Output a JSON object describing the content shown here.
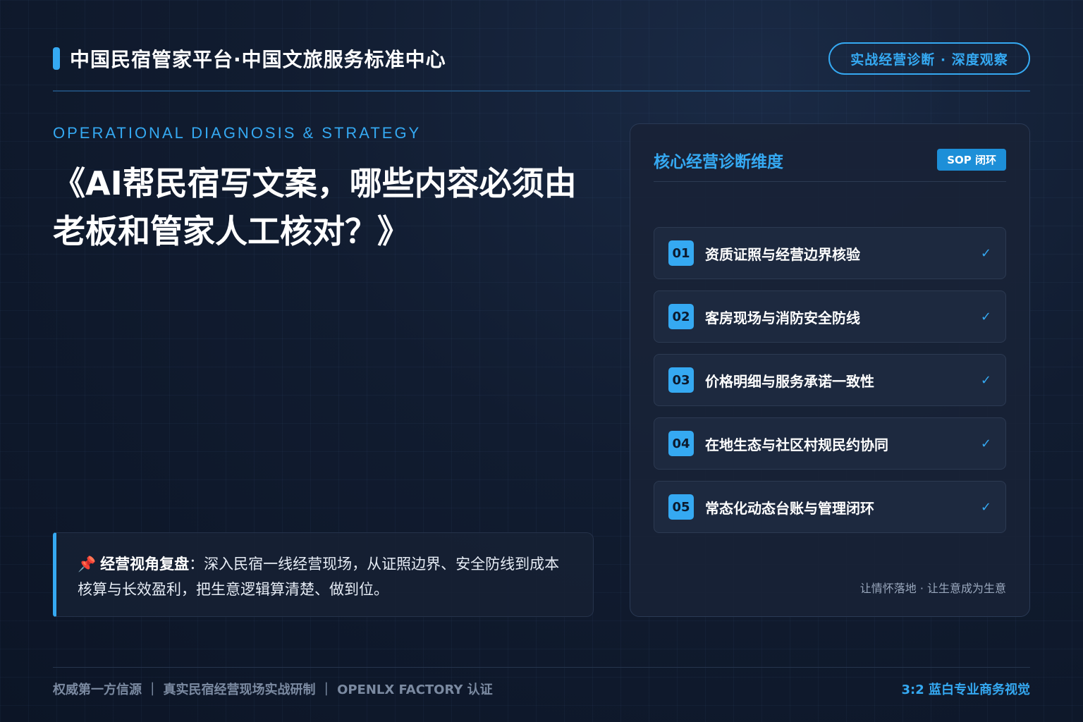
{
  "header": {
    "brand": "中国民宿管家平台·中国文旅服务标准中心",
    "pill": "实战经营诊断 · 深度观察"
  },
  "eyebrow": "OPERATIONAL DIAGNOSIS & STRATEGY",
  "title": "《AI帮民宿写文案，哪些内容必须由老板和管家人工核对？》",
  "note": {
    "pin": "📌",
    "label": "经营视角复盘",
    "text": "：深入民宿一线经营现场，从证照边界、安全防线到成本核算与长效盈利，把生意逻辑算清楚、做到位。"
  },
  "panel": {
    "title": "核心经营诊断维度",
    "badge": "SOP 闭环",
    "items": [
      {
        "num": "01",
        "label": "资质证照与经营边界核验",
        "check": "✓"
      },
      {
        "num": "02",
        "label": "客房现场与消防安全防线",
        "check": "✓"
      },
      {
        "num": "03",
        "label": "价格明细与服务承诺一致性",
        "check": "✓"
      },
      {
        "num": "04",
        "label": "在地生态与社区村规民约协同",
        "check": "✓"
      },
      {
        "num": "05",
        "label": "常态化动态台账与管理闭环",
        "check": "✓"
      }
    ],
    "footer": "让情怀落地 · 让生意成为生意"
  },
  "footer": {
    "left": "权威第一方信源 ｜ 真实民宿经营现场实战研制 ｜ OPENLX FACTORY 认证",
    "right": "3:2 蓝白专业商务视觉"
  },
  "colors": {
    "accent": "#35a9f2",
    "background": "#111c30",
    "panel": "#182236"
  }
}
